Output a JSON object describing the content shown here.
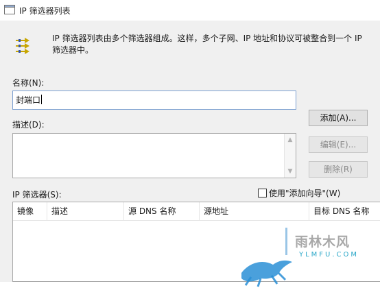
{
  "window": {
    "title": "IP 筛选器列表"
  },
  "intro": {
    "line1": "IP 筛选器列表由多个筛选器组成。这样，多个子网、IP 地址和协议可被整合到一个 IP",
    "line2": "筛选器中。"
  },
  "name": {
    "label": "名称(N):",
    "value": "封端口"
  },
  "description": {
    "label": "描述(D):",
    "value": ""
  },
  "buttons": {
    "add": "添加(A)...",
    "edit": "编辑(E)...",
    "delete": "删除(R)"
  },
  "wizard": {
    "label": "使用\"添加向导\"(W)",
    "checked": false
  },
  "filters": {
    "label": "IP 筛选器(S):",
    "columns": [
      "镜像",
      "描述",
      "源 DNS 名称",
      "源地址",
      "目标 DNS 名称"
    ]
  },
  "watermark": {
    "brand": "雨林木风",
    "url": "YLMFU.COM"
  }
}
